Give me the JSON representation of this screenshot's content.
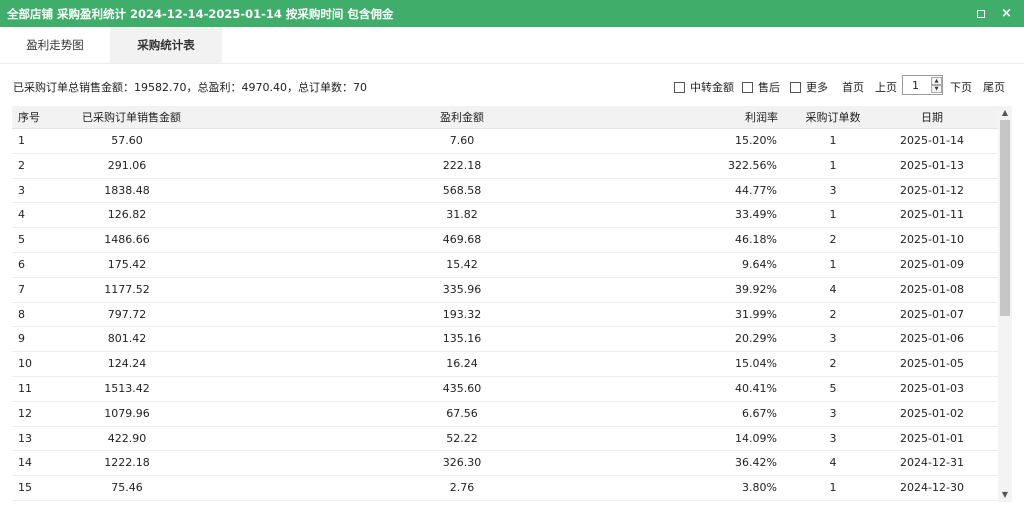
{
  "window": {
    "title": "全部店铺 采购盈利统计 2024-12-14-2025-01-14 按采购时间 包含佣金",
    "maximize_icon": "maximize-icon",
    "close_icon": "close-icon",
    "close_glyph": "×"
  },
  "tabs": [
    {
      "label": "盈利走势图",
      "active": false
    },
    {
      "label": "采购统计表",
      "active": true
    }
  ],
  "summary": "已采购订单总销售金额：19582.70，总盈利：4970.40，总订单数：70",
  "filters": {
    "zhongzhuan": "中转金额",
    "shouhou": "售后",
    "gengduo": "更多"
  },
  "pager": {
    "first": "首页",
    "prev": "上页",
    "page": "1",
    "next": "下页",
    "last": "尾页",
    "up_glyph": "▲",
    "down_glyph": "▼"
  },
  "table": {
    "headers": {
      "seq": "序号",
      "sales": "已采购订单销售金额",
      "profit": "盈利金额",
      "rate": "利润率",
      "count": "采购订单数",
      "date": "日期"
    },
    "rows": [
      {
        "seq": "1",
        "sales": "57.60",
        "profit": "7.60",
        "rate": "15.20%",
        "count": "1",
        "date": "2025-01-14"
      },
      {
        "seq": "2",
        "sales": "291.06",
        "profit": "222.18",
        "rate": "322.56%",
        "count": "1",
        "date": "2025-01-13"
      },
      {
        "seq": "3",
        "sales": "1838.48",
        "profit": "568.58",
        "rate": "44.77%",
        "count": "3",
        "date": "2025-01-12"
      },
      {
        "seq": "4",
        "sales": "126.82",
        "profit": "31.82",
        "rate": "33.49%",
        "count": "1",
        "date": "2025-01-11"
      },
      {
        "seq": "5",
        "sales": "1486.66",
        "profit": "469.68",
        "rate": "46.18%",
        "count": "2",
        "date": "2025-01-10"
      },
      {
        "seq": "6",
        "sales": "175.42",
        "profit": "15.42",
        "rate": "9.64%",
        "count": "1",
        "date": "2025-01-09"
      },
      {
        "seq": "7",
        "sales": "1177.52",
        "profit": "335.96",
        "rate": "39.92%",
        "count": "4",
        "date": "2025-01-08"
      },
      {
        "seq": "8",
        "sales": "797.72",
        "profit": "193.32",
        "rate": "31.99%",
        "count": "2",
        "date": "2025-01-07"
      },
      {
        "seq": "9",
        "sales": "801.42",
        "profit": "135.16",
        "rate": "20.29%",
        "count": "3",
        "date": "2025-01-06"
      },
      {
        "seq": "10",
        "sales": "124.24",
        "profit": "16.24",
        "rate": "15.04%",
        "count": "2",
        "date": "2025-01-05"
      },
      {
        "seq": "11",
        "sales": "1513.42",
        "profit": "435.60",
        "rate": "40.41%",
        "count": "5",
        "date": "2025-01-03"
      },
      {
        "seq": "12",
        "sales": "1079.96",
        "profit": "67.56",
        "rate": "6.67%",
        "count": "3",
        "date": "2025-01-02"
      },
      {
        "seq": "13",
        "sales": "422.90",
        "profit": "52.22",
        "rate": "14.09%",
        "count": "3",
        "date": "2025-01-01"
      },
      {
        "seq": "14",
        "sales": "1222.18",
        "profit": "326.30",
        "rate": "36.42%",
        "count": "4",
        "date": "2024-12-31"
      },
      {
        "seq": "15",
        "sales": "75.46",
        "profit": "2.76",
        "rate": "3.80%",
        "count": "1",
        "date": "2024-12-30"
      }
    ]
  },
  "scrollbar": {
    "up_glyph": "▲",
    "down_glyph": "▼"
  },
  "colors": {
    "titlebar": "#3fae6a",
    "active_tab": "#f2f2f2",
    "header_bg": "#f2f2f2"
  }
}
